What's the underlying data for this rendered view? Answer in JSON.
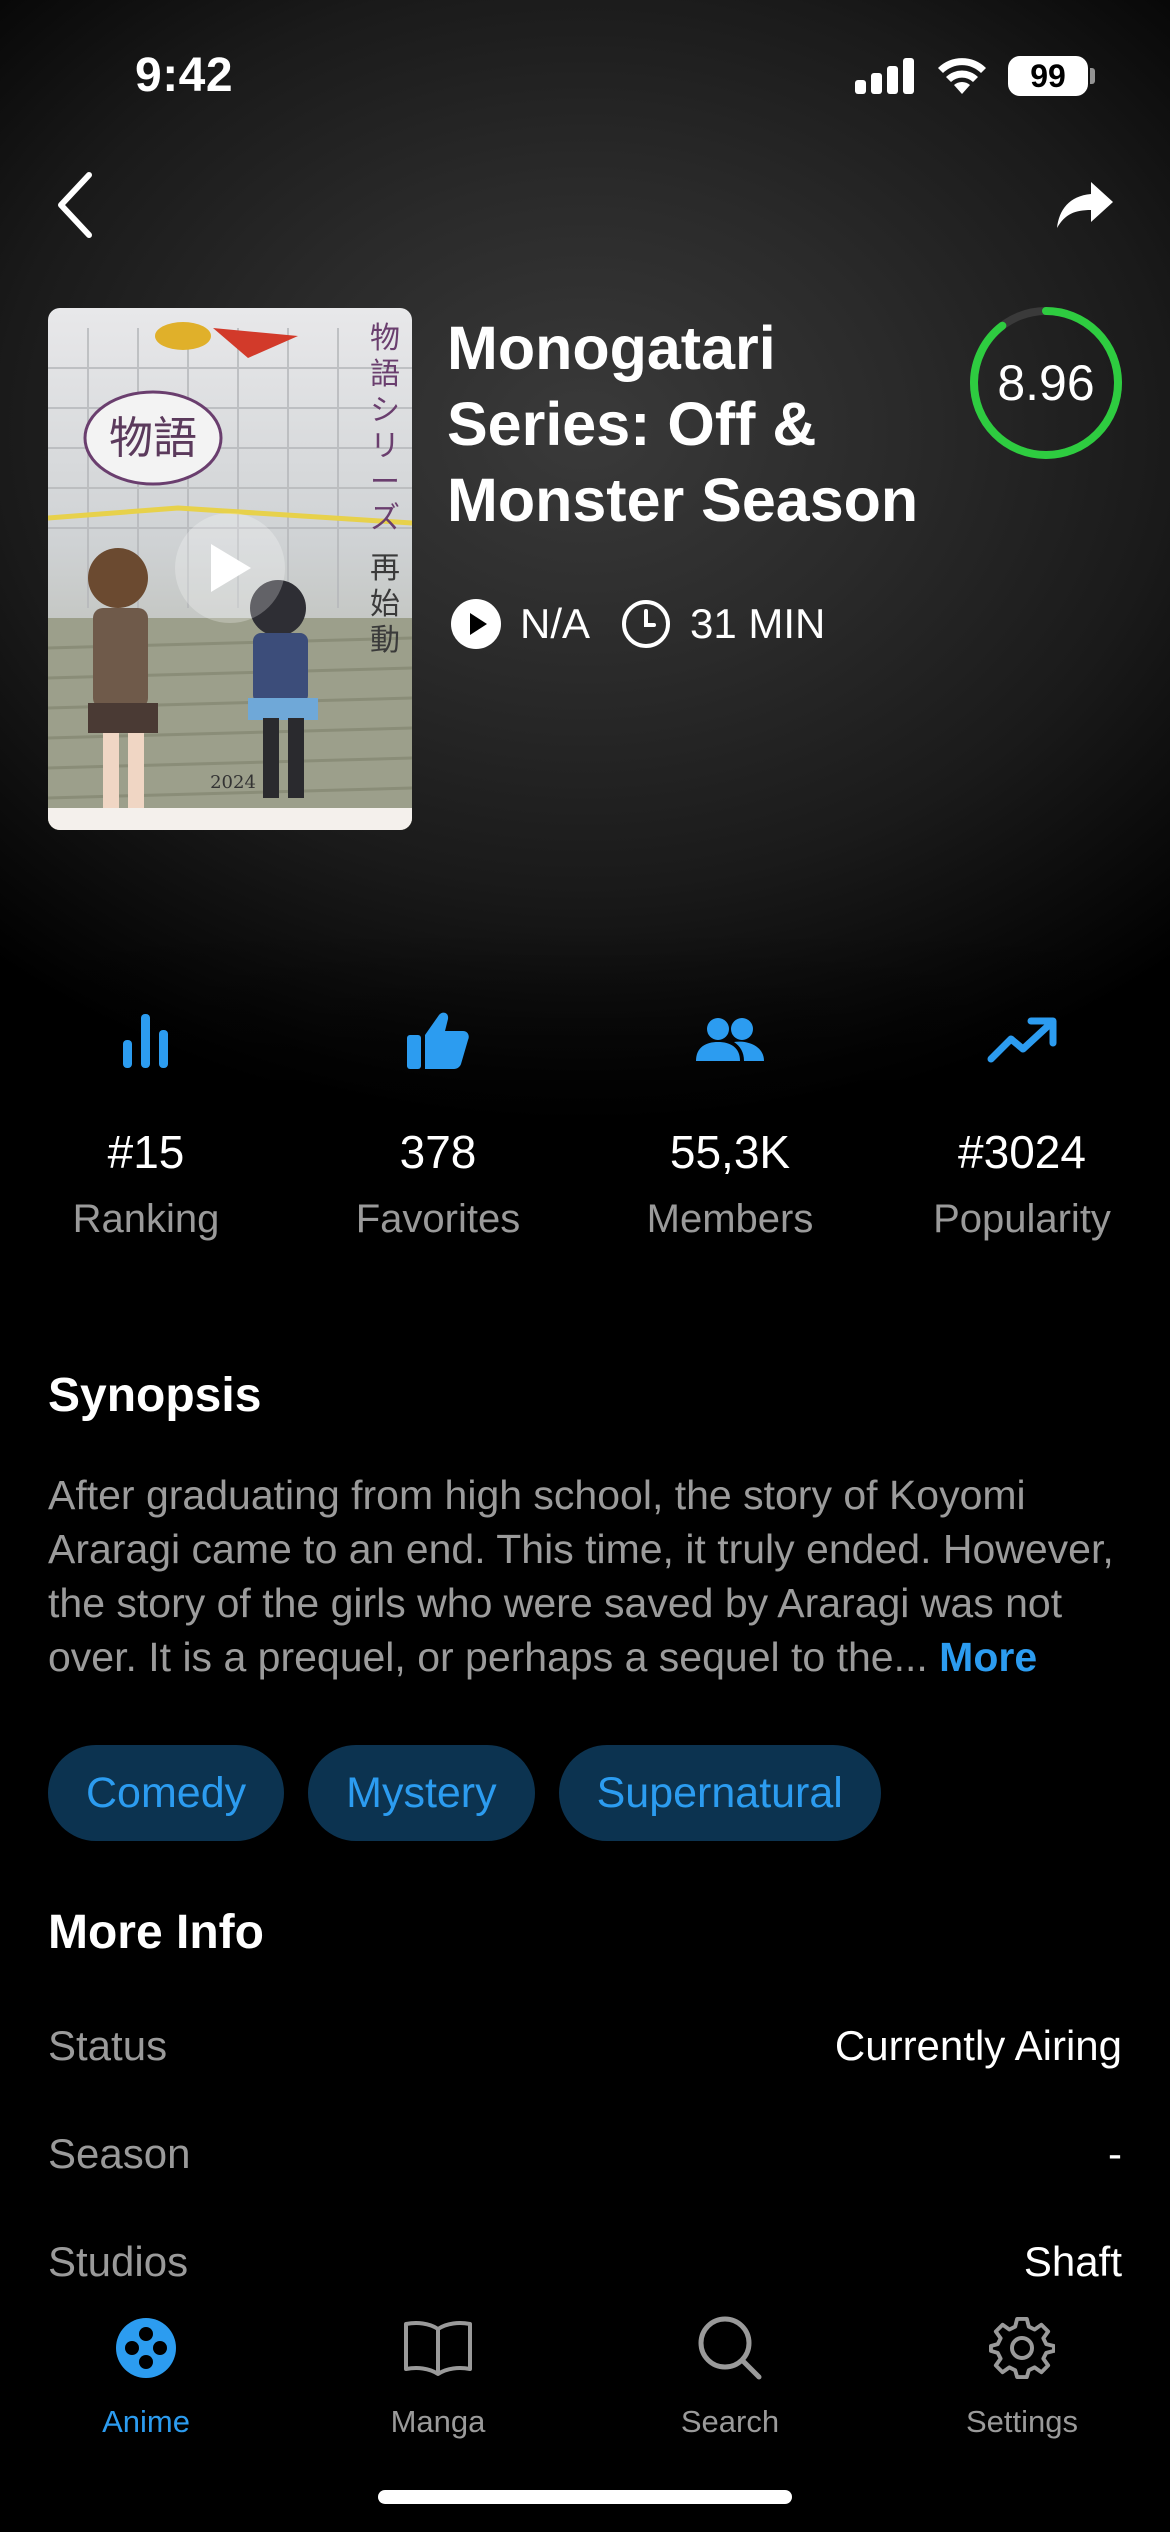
{
  "status_bar": {
    "time": "9:42",
    "battery": "99"
  },
  "nav": {
    "back_icon": "chevron-left-icon",
    "share_icon": "share-arrow-icon"
  },
  "anime": {
    "title": "Monogatari Series: Off & Monster Season",
    "score": "8.96",
    "score_fraction": 0.896,
    "episodes": "N/A",
    "duration": "31 MIN",
    "poster_play_icon": "play-icon"
  },
  "stats": [
    {
      "icon": "bar-chart-icon",
      "value": "#15",
      "label": "Ranking"
    },
    {
      "icon": "thumbs-up-icon",
      "value": "378",
      "label": "Favorites"
    },
    {
      "icon": "people-icon",
      "value": "55,3K",
      "label": "Members"
    },
    {
      "icon": "trending-up-icon",
      "value": "#3024",
      "label": "Popularity"
    }
  ],
  "synopsis": {
    "title": "Synopsis",
    "text": "After graduating from high school, the story of Koyomi Araragi came to an end. This time, it truly ended. However, the story of the girls who were saved by Araragi was not over. It is a prequel, or perhaps a sequel to the...",
    "more_label": "More"
  },
  "genres": [
    "Comedy",
    "Mystery",
    "Supernatural"
  ],
  "more_info": {
    "title": "More Info",
    "rows": [
      {
        "key": "Status",
        "value": "Currently Airing"
      },
      {
        "key": "Season",
        "value": "-"
      },
      {
        "key": "Studios",
        "value": "Shaft"
      }
    ]
  },
  "tabs": [
    {
      "label": "Anime",
      "icon": "film-reel-icon",
      "active": true
    },
    {
      "label": "Manga",
      "icon": "book-icon",
      "active": false
    },
    {
      "label": "Search",
      "icon": "search-icon",
      "active": false
    },
    {
      "label": "Settings",
      "icon": "gear-icon",
      "active": false
    }
  ],
  "colors": {
    "accent": "#2c9cf0",
    "score_ring": "#2ecc40",
    "chip_bg": "#0c3350",
    "muted_text": "#9a9a9a"
  }
}
